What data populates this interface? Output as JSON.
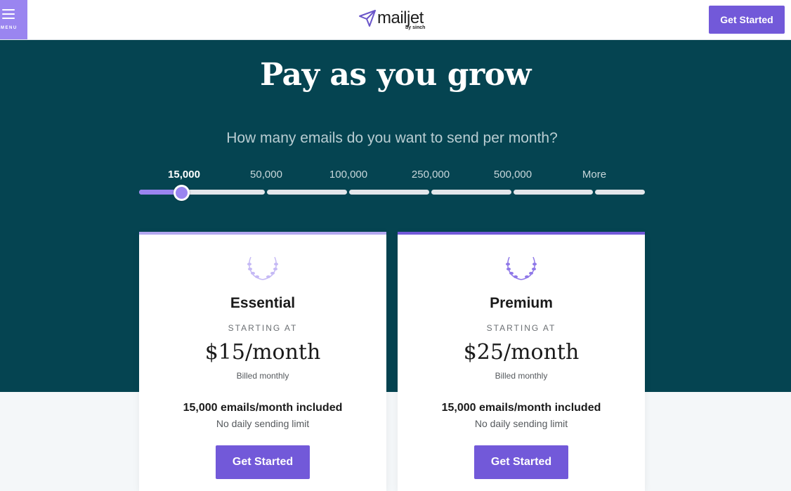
{
  "header": {
    "menu_label": "MENU",
    "logo_text": "mailjet",
    "logo_sub": "by sinch",
    "cta_label": "Get Started"
  },
  "hero": {
    "title": "Pay as you grow",
    "question": "How many emails do you want to send per month?"
  },
  "slider": {
    "tiers": [
      "15,000",
      "50,000",
      "100,000",
      "250,000",
      "500,000",
      "More"
    ],
    "selected": "15,000",
    "accent_color": "#9a85f0"
  },
  "plans": [
    {
      "name": "Essential",
      "starting_label": "STARTING AT",
      "price": "$15/month",
      "billing": "Billed monthly",
      "emails": "15,000 emails/month included",
      "limit": "No daily sending limit",
      "cta": "Get Started",
      "icon": "laurel-icon"
    },
    {
      "name": "Premium",
      "starting_label": "STARTING AT",
      "price": "$25/month",
      "billing": "Billed monthly",
      "emails": "15,000 emails/month included",
      "limit": "No daily sending limit",
      "cta": "Get Started",
      "icon": "laurel-icon"
    }
  ],
  "colors": {
    "hero_bg": "#054451",
    "brand_purple": "#7259d9",
    "light_purple": "#9a85f0"
  }
}
